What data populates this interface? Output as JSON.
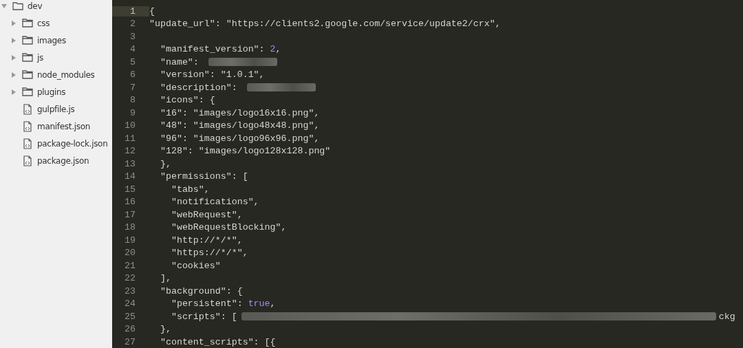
{
  "sidebar": {
    "root": {
      "label": "dev",
      "expanded": true
    },
    "items": [
      {
        "kind": "folder",
        "label": "css",
        "expanded": false
      },
      {
        "kind": "folder",
        "label": "images",
        "expanded": false
      },
      {
        "kind": "folder",
        "label": "js",
        "expanded": false
      },
      {
        "kind": "folder",
        "label": "node_modules",
        "expanded": false
      },
      {
        "kind": "folder",
        "label": "plugins",
        "expanded": false
      },
      {
        "kind": "file",
        "label": "gulpfile.js"
      },
      {
        "kind": "file",
        "label": "manifest.json"
      },
      {
        "kind": "file",
        "label": "package-lock.json"
      },
      {
        "kind": "file",
        "label": "package.json"
      }
    ]
  },
  "editor": {
    "lines": [
      {
        "number": "1",
        "current": true,
        "segments": [
          {
            "kind": "plain",
            "text": "{"
          }
        ]
      },
      {
        "number": "2",
        "current": false,
        "segments": [
          {
            "kind": "plain",
            "text": "\"update_url\": \"https://clients2.google.com/service/update2/crx\","
          }
        ]
      },
      {
        "number": "3",
        "current": false
      },
      {
        "number": "4",
        "current": false,
        "segments": [
          {
            "kind": "plain",
            "text": "  \"manifest_version\": "
          },
          {
            "kind": "constant",
            "text": "2"
          },
          {
            "kind": "plain",
            "text": ","
          }
        ]
      },
      {
        "number": "5",
        "current": false,
        "segments": [
          {
            "kind": "plain",
            "text": "  \"name\": "
          },
          {
            "kind": "redaction-short"
          }
        ]
      },
      {
        "number": "6",
        "current": false,
        "segments": [
          {
            "kind": "plain",
            "text": "  \"version\": \"1.0.1\","
          }
        ]
      },
      {
        "number": "7",
        "current": false,
        "segments": [
          {
            "kind": "plain",
            "text": "  \"description\": "
          },
          {
            "kind": "redaction-short"
          }
        ]
      },
      {
        "number": "8",
        "current": false,
        "segments": [
          {
            "kind": "plain",
            "text": "  \"icons\": {"
          }
        ]
      },
      {
        "number": "9",
        "current": false,
        "segments": [
          {
            "kind": "plain",
            "text": "  \"16\": \"images/logo16x16.png\","
          }
        ]
      },
      {
        "number": "10",
        "current": false,
        "segments": [
          {
            "kind": "plain",
            "text": "  \"48\": \"images/logo48x48.png\","
          }
        ]
      },
      {
        "number": "11",
        "current": false,
        "segments": [
          {
            "kind": "plain",
            "text": "  \"96\": \"images/logo96x96.png\","
          }
        ]
      },
      {
        "number": "12",
        "current": false,
        "segments": [
          {
            "kind": "plain",
            "text": "  \"128\": \"images/logo128x128.png\""
          }
        ]
      },
      {
        "number": "13",
        "current": false,
        "segments": [
          {
            "kind": "plain",
            "text": "  },"
          }
        ]
      },
      {
        "number": "14",
        "current": false,
        "segments": [
          {
            "kind": "plain",
            "text": "  \"permissions\": ["
          }
        ]
      },
      {
        "number": "15",
        "current": false,
        "segments": [
          {
            "kind": "plain",
            "text": "    \"tabs\","
          }
        ]
      },
      {
        "number": "16",
        "current": false,
        "segments": [
          {
            "kind": "plain",
            "text": "    \"notifications\","
          }
        ]
      },
      {
        "number": "17",
        "current": false,
        "segments": [
          {
            "kind": "plain",
            "text": "    \"webRequest\","
          }
        ]
      },
      {
        "number": "18",
        "current": false,
        "segments": [
          {
            "kind": "plain",
            "text": "    \"webRequestBlocking\","
          }
        ]
      },
      {
        "number": "19",
        "current": false,
        "segments": [
          {
            "kind": "plain",
            "text": "    \"http://*/*\","
          }
        ]
      },
      {
        "number": "20",
        "current": false,
        "segments": [
          {
            "kind": "plain",
            "text": "    \"https://*/*\","
          }
        ]
      },
      {
        "number": "21",
        "current": false,
        "segments": [
          {
            "kind": "plain",
            "text": "    \"cookies\""
          }
        ]
      },
      {
        "number": "22",
        "current": false,
        "segments": [
          {
            "kind": "plain",
            "text": "  ],"
          }
        ]
      },
      {
        "number": "23",
        "current": false,
        "segments": [
          {
            "kind": "plain",
            "text": "  \"background\": {"
          }
        ]
      },
      {
        "number": "24",
        "current": false,
        "segments": [
          {
            "kind": "plain",
            "text": "    \"persistent\": "
          },
          {
            "kind": "constant",
            "text": "true"
          },
          {
            "kind": "plain",
            "text": ","
          }
        ]
      },
      {
        "number": "25",
        "current": false,
        "segments": [
          {
            "kind": "plain",
            "text": "    \"scripts\": ["
          },
          {
            "kind": "redaction-long"
          },
          {
            "kind": "plain",
            "text": "ckg"
          }
        ]
      },
      {
        "number": "26",
        "current": false,
        "segments": [
          {
            "kind": "plain",
            "text": "  },"
          }
        ]
      },
      {
        "number": "27",
        "current": false,
        "segments": [
          {
            "kind": "plain",
            "text": "  \"content_scripts\": [{"
          }
        ]
      }
    ]
  }
}
